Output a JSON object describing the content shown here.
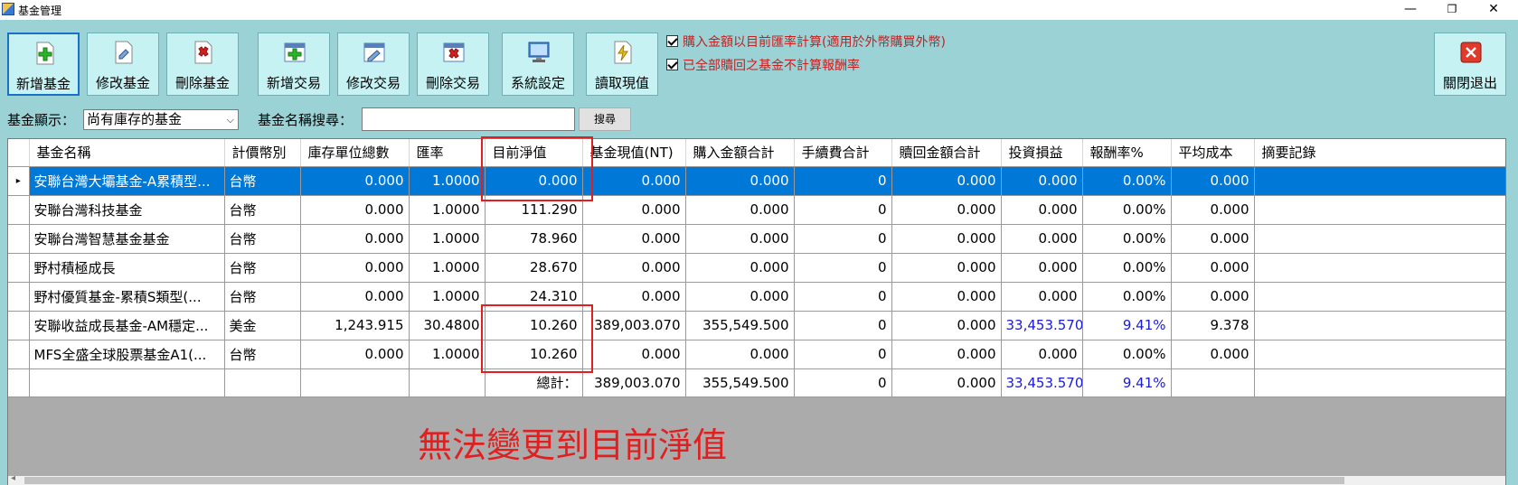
{
  "window": {
    "title": "基金管理",
    "minimize": "—",
    "maximize": "❐",
    "close": "✕"
  },
  "toolbar": {
    "add_fund": "新增基金",
    "edit_fund": "修改基金",
    "delete_fund": "刪除基金",
    "add_trade": "新增交易",
    "edit_trade": "修改交易",
    "delete_trade": "刪除交易",
    "settings": "系統設定",
    "read_nav": "讀取現值",
    "close_exit": "關閉退出"
  },
  "options": {
    "fx_rate_checkbox": "購入金額以目前匯率計算(適用於外幣購買外幣)",
    "exclude_redeemed_checkbox": "已全部贖回之基金不計算報酬率",
    "fx_rate_checked": true,
    "exclude_redeemed_checked": true
  },
  "filter": {
    "display_label": "基金顯示：",
    "display_value": "尚有庫存的基金",
    "search_label": "基金名稱搜尋：",
    "search_value": "",
    "search_button": "搜尋"
  },
  "grid": {
    "columns": [
      "基金名稱",
      "計價幣別",
      "庫存單位總數",
      "匯率",
      "目前淨值",
      "基金現值(NT)",
      "購入金額合計",
      "手續費合計",
      "贖回金額合計",
      "投資損益",
      "報酬率%",
      "平均成本",
      "摘要記錄"
    ],
    "rows": [
      {
        "name": "安聯台灣大壩基金-A累積型...",
        "currency": "台幣",
        "units": "0.000",
        "fx": "1.0000",
        "nav": "0.000",
        "value_nt": "0.000",
        "purchase": "0.000",
        "fee": "0",
        "redeem": "0.000",
        "pnl": "0.000",
        "return": "0.00%",
        "avg_cost": "0.000",
        "memo": "",
        "selected": true
      },
      {
        "name": "安聯台灣科技基金",
        "currency": "台幣",
        "units": "0.000",
        "fx": "1.0000",
        "nav": "111.290",
        "value_nt": "0.000",
        "purchase": "0.000",
        "fee": "0",
        "redeem": "0.000",
        "pnl": "0.000",
        "return": "0.00%",
        "avg_cost": "0.000",
        "memo": ""
      },
      {
        "name": "安聯台灣智慧基金基金",
        "currency": "台幣",
        "units": "0.000",
        "fx": "1.0000",
        "nav": "78.960",
        "value_nt": "0.000",
        "purchase": "0.000",
        "fee": "0",
        "redeem": "0.000",
        "pnl": "0.000",
        "return": "0.00%",
        "avg_cost": "0.000",
        "memo": ""
      },
      {
        "name": "野村積極成長",
        "currency": "台幣",
        "units": "0.000",
        "fx": "1.0000",
        "nav": "28.670",
        "value_nt": "0.000",
        "purchase": "0.000",
        "fee": "0",
        "redeem": "0.000",
        "pnl": "0.000",
        "return": "0.00%",
        "avg_cost": "0.000",
        "memo": ""
      },
      {
        "name": "野村優質基金-累積S類型(...",
        "currency": "台幣",
        "units": "0.000",
        "fx": "1.0000",
        "nav": "24.310",
        "value_nt": "0.000",
        "purchase": "0.000",
        "fee": "0",
        "redeem": "0.000",
        "pnl": "0.000",
        "return": "0.00%",
        "avg_cost": "0.000",
        "memo": ""
      },
      {
        "name": "安聯收益成長基金-AM穩定...",
        "currency": "美金",
        "units": "1,243.915",
        "fx": "30.4800",
        "nav": "10.260",
        "value_nt": "389,003.070",
        "purchase": "355,549.500",
        "fee": "0",
        "redeem": "0.000",
        "pnl": "33,453.570",
        "return": "9.41%",
        "avg_cost": "9.378",
        "memo": "",
        "blue": true
      },
      {
        "name": "MFS全盛全球股票基金A1(...",
        "currency": "台幣",
        "units": "0.000",
        "fx": "1.0000",
        "nav": "10.260",
        "value_nt": "0.000",
        "purchase": "0.000",
        "fee": "0",
        "redeem": "0.000",
        "pnl": "0.000",
        "return": "0.00%",
        "avg_cost": "0.000",
        "memo": ""
      }
    ],
    "totals": {
      "label": "總計：",
      "value_nt": "389,003.070",
      "purchase": "355,549.500",
      "fee": "0",
      "redeem": "0.000",
      "pnl": "33,453.570",
      "return": "9.41%"
    }
  },
  "annotation": {
    "text": "無法變更到目前淨值",
    "color": "#e02020"
  },
  "colors": {
    "background": "#9bd2d5",
    "button_face": "#c7f2f4",
    "selection": "#0078d7",
    "positive_blue": "#1a1ad8",
    "checkbox_text": "#c81e1e"
  }
}
